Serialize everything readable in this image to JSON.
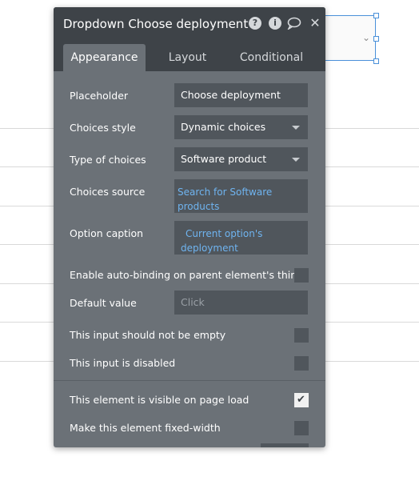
{
  "panel": {
    "title": "Dropdown Choose deployment",
    "header_icons": [
      "help-icon",
      "info-icon",
      "comment-icon",
      "close-icon"
    ]
  },
  "tabs": [
    "Appearance",
    "Layout",
    "Conditional"
  ],
  "active_tab": "Appearance",
  "fields": {
    "placeholder_label": "Placeholder",
    "placeholder_value": "Choose deployment",
    "choices_style_label": "Choices style",
    "choices_style_value": "Dynamic choices",
    "type_label": "Type of choices",
    "type_value": "Software product",
    "source_label": "Choices source",
    "source_value": "Search for Software products",
    "caption_label": "Option caption",
    "caption_value": "Current option's deployment",
    "auto_binding_label": "Enable auto-binding on parent element's thing",
    "default_label": "Default value",
    "default_placeholder": "Click",
    "not_empty_label": "This input should not be empty",
    "disabled_label": "This input is disabled",
    "visible_label": "This element is visible on page load",
    "fixed_width_label": "Make this element fixed-width"
  },
  "checkboxes": {
    "auto_binding": false,
    "not_empty": false,
    "disabled": false,
    "visible": true,
    "fixed_width": false
  }
}
